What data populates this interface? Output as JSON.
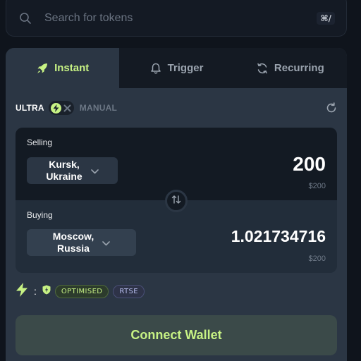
{
  "search": {
    "placeholder": "Search for tokens",
    "shortcut": "⌘/"
  },
  "tabs": [
    {
      "label": "Instant",
      "icon": "rocket-icon",
      "active": true
    },
    {
      "label": "Trigger",
      "icon": "bell-icon",
      "active": false
    },
    {
      "label": "Recurring",
      "icon": "recurring-icon",
      "active": false
    }
  ],
  "mode": {
    "ultra_label": "ULTRA",
    "manual_label": "MANUAL",
    "ultra_enabled": true
  },
  "selling": {
    "label": "Selling",
    "token": "Kursk,\nUkraine",
    "amount": "200",
    "usd": "$200"
  },
  "buying": {
    "label": "Buying",
    "token": "Moscow,\nRussia",
    "amount": "1.021734716",
    "usd": "$200"
  },
  "route": {
    "colon": ":",
    "badges": [
      "OPTIMISED",
      "RTSE"
    ]
  },
  "connect_label": "Connect Wallet",
  "colors": {
    "accent": "#c7f284",
    "panel": "#2b3644",
    "background": "#0f141c"
  }
}
